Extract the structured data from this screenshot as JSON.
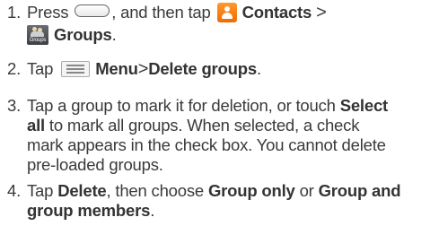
{
  "steps": [
    {
      "num": "1.",
      "press": "Press",
      "then_tap": ", and then tap",
      "contacts": "Contacts",
      "sep": ">",
      "groups": "Groups",
      "end": ".",
      "groups_icon_label": "Groups"
    },
    {
      "num": "2.",
      "tap": "Tap",
      "menu": "Menu",
      "sep": ">",
      "delete_groups": "Delete groups",
      "end": "."
    },
    {
      "num": "3.",
      "line1_a": "Tap a group to mark it for deletion, or touch",
      "select": "Select",
      "all": "all",
      "line2_b": "to mark all groups. When selected, a check",
      "line3": "mark appears in the check box. You cannot delete",
      "line4": "pre-loaded groups."
    },
    {
      "num": "4.",
      "tap": "Tap",
      "delete": "Delete",
      "then_choose": ", then choose",
      "group_only": "Group only",
      "or": "or",
      "group_and": "Group and",
      "group_members": "group members",
      "end": "."
    }
  ],
  "icons": {
    "home_key": "home-key-icon",
    "contacts": "contacts-icon",
    "groups": "groups-icon",
    "menu": "menu-icon"
  }
}
